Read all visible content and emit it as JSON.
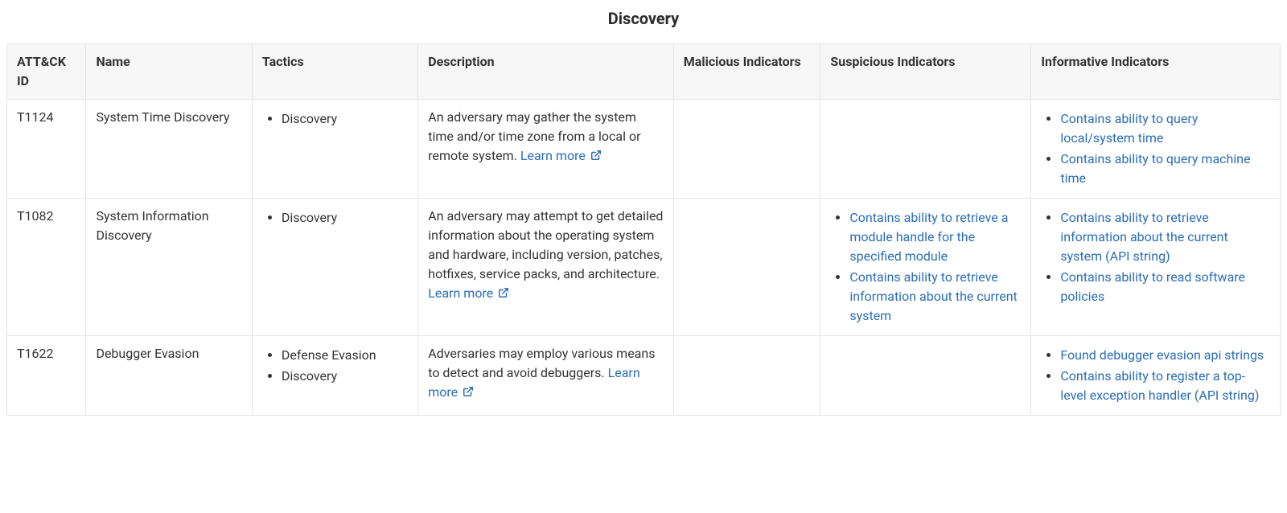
{
  "section_title": "Discovery",
  "columns": {
    "id": "ATT&CK ID",
    "name": "Name",
    "tactics": "Tactics",
    "description": "Description",
    "malicious": "Malicious Indicators",
    "suspicious": "Suspicious Indicators",
    "informative": "Informative Indicators"
  },
  "learn_more": "Learn more",
  "rows": [
    {
      "id": "T1124",
      "name": "System Time Discovery",
      "tactics": [
        "Discovery"
      ],
      "description": "An adversary may gather the system time and/or time zone from a local or remote system.",
      "malicious": [],
      "suspicious": [],
      "informative": [
        "Contains ability to query local/system time",
        "Contains ability to query machine time"
      ]
    },
    {
      "id": "T1082",
      "name": "System Information Discovery",
      "tactics": [
        "Discovery"
      ],
      "description": "An adversary may attempt to get detailed information about the operating system and hardware, including version, patches, hotfixes, service packs, and architecture.",
      "malicious": [],
      "suspicious": [
        "Contains ability to retrieve a module handle for the specified module",
        "Contains ability to retrieve information about the current system"
      ],
      "informative": [
        "Contains ability to retrieve information about the current system (API string)",
        "Contains ability to read software policies"
      ]
    },
    {
      "id": "T1622",
      "name": "Debugger Evasion",
      "tactics": [
        "Defense Evasion",
        "Discovery"
      ],
      "description": "Adversaries may employ various means to detect and avoid debuggers.",
      "malicious": [],
      "suspicious": [],
      "informative": [
        "Found debugger evasion api strings",
        "Contains ability to register a top-level exception handler (API string)"
      ]
    }
  ]
}
